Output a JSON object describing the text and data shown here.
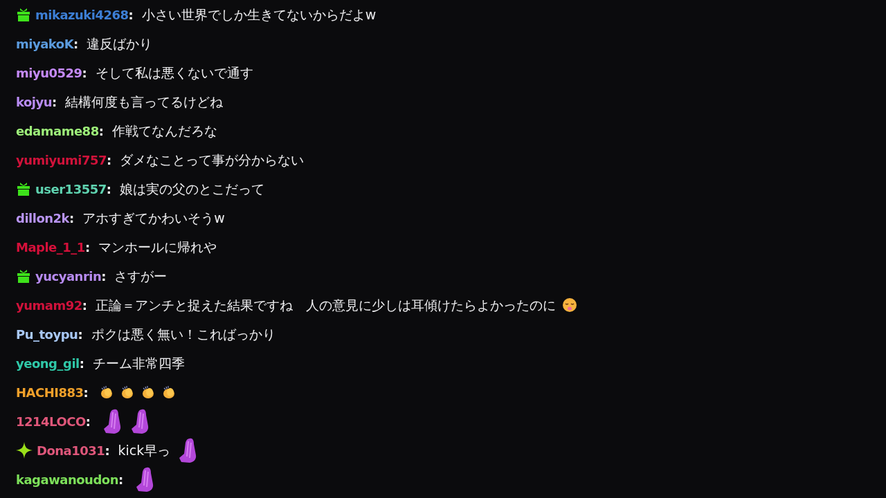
{
  "messages": [
    {
      "badge": {
        "kind": "gift"
      },
      "user": "mikazuki4268",
      "sep": ":",
      "color": "#3d7fd6",
      "parts": [
        {
          "kind": "text",
          "text": "小さい世界でしか生きてないからだよw"
        }
      ]
    },
    {
      "user": "miyakoK",
      "sep": ":",
      "color": "#5b9bde",
      "parts": [
        {
          "kind": "text",
          "text": "違反ばかり"
        }
      ]
    },
    {
      "user": "miyu0529",
      "sep": ":",
      "color": "#c58af9",
      "parts": [
        {
          "kind": "text",
          "text": "そして私は悪くないで通す"
        }
      ]
    },
    {
      "user": "kojyu",
      "sep": ":",
      "color": "#b98cf5",
      "parts": [
        {
          "kind": "text",
          "text": "結構何度も言ってるけどね"
        }
      ]
    },
    {
      "user": "edamame88",
      "sep": ":",
      "color": "#9ef07a",
      "parts": [
        {
          "kind": "text",
          "text": "作戦てなんだろな"
        }
      ]
    },
    {
      "user": "yumiyumi757",
      "sep": ":",
      "color": "#d0123a",
      "parts": [
        {
          "kind": "text",
          "text": "ダメなことって事が分からない"
        }
      ]
    },
    {
      "badge": {
        "kind": "gift"
      },
      "user": "user13557",
      "sep": ":",
      "color": "#5fd3b0",
      "parts": [
        {
          "kind": "text",
          "text": "娘は実の父のとこだって"
        }
      ]
    },
    {
      "user": "dillon2k",
      "sep": ":",
      "color": "#b894f2",
      "parts": [
        {
          "kind": "text",
          "text": "アホすぎてかわいそうw"
        }
      ]
    },
    {
      "user": "Maple_1_1",
      "sep": ":",
      "color": "#d4103a",
      "parts": [
        {
          "kind": "text",
          "text": "マンホールに帰れや"
        }
      ]
    },
    {
      "badge": {
        "kind": "gift"
      },
      "user": "yucyanrin",
      "sep": ":",
      "color": "#b78bf0",
      "parts": [
        {
          "kind": "text",
          "text": "さすがー"
        }
      ]
    },
    {
      "user": "yumam92",
      "sep": ":",
      "color": "#d0123b",
      "parts": [
        {
          "kind": "text",
          "text": "正論＝アンチと捉えた結果ですね　人の意見に少しは耳傾けたらよかったのに"
        },
        {
          "kind": "face"
        }
      ]
    },
    {
      "user": "Pu_toypu",
      "sep": ":",
      "color": "#a9c8f5",
      "parts": [
        {
          "kind": "text",
          "text": "ポクは悪く無い！こればっかり"
        }
      ]
    },
    {
      "user": "yeong_gil",
      "sep": ":",
      "color": "#2fc8a8",
      "parts": [
        {
          "kind": "text",
          "text": "チーム非常四季"
        }
      ]
    },
    {
      "user": "HACHI883",
      "sep": ":",
      "color": "#f0a02a",
      "parts": [
        {
          "kind": "clap"
        },
        {
          "kind": "clap"
        },
        {
          "kind": "clap"
        },
        {
          "kind": "clap"
        }
      ]
    },
    {
      "user": "1214LOCO",
      "sep": ":",
      "color": "#e0577a",
      "parts": [
        {
          "kind": "pray"
        },
        {
          "kind": "pray"
        }
      ]
    },
    {
      "badge": {
        "kind": "sparkle"
      },
      "user": "Dona1031",
      "sep": ":",
      "color": "#e0577b",
      "parts": [
        {
          "kind": "text",
          "text": "kick早っ"
        },
        {
          "kind": "pray"
        }
      ]
    },
    {
      "user": "kagawanoudon",
      "sep": ":",
      "color": "#7de05a",
      "parts": [
        {
          "kind": "pray"
        }
      ]
    }
  ]
}
